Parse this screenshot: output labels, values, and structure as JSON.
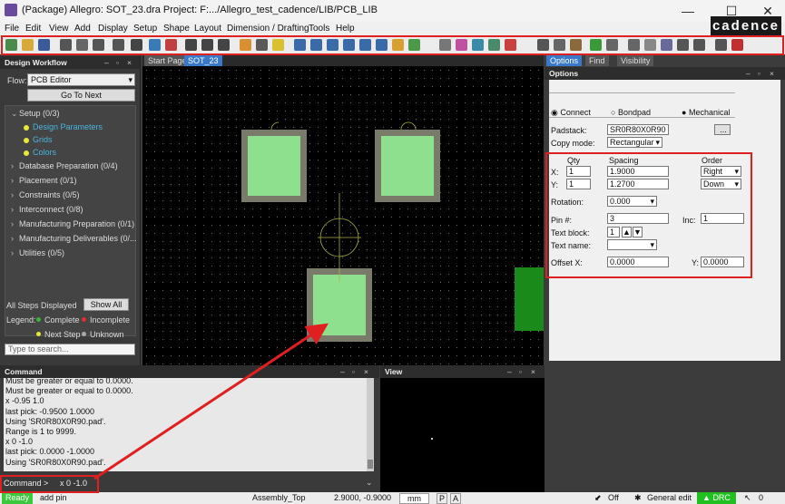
{
  "window": {
    "title": "(Package) Allegro: SOT_23.dra  Project: F:.../Allegro_test_cadence/LIB/PCB_LIB",
    "minimize": "—",
    "maximize": "☐",
    "close": "✕"
  },
  "menu": {
    "items": [
      "File",
      "Edit",
      "View",
      "Add",
      "Display",
      "Setup",
      "Shape",
      "Layout",
      "Dimension / Drafting",
      "Tools",
      "Help"
    ]
  },
  "brand": "cadence",
  "workflow": {
    "title": "Design Workflow",
    "flow_label": "Flow:",
    "flow_value": "PCB Editor",
    "goto": "Go To Next",
    "tree": [
      {
        "label": "Setup  (0/3)",
        "expanded": true
      },
      {
        "label": "Design Parameters",
        "sub": true
      },
      {
        "label": "Grids",
        "sub": true
      },
      {
        "label": "Colors",
        "sub": true
      },
      {
        "label": "Database Preparation  (0/4)"
      },
      {
        "label": "Placement  (0/1)"
      },
      {
        "label": "Constraints  (0/5)"
      },
      {
        "label": "Interconnect  (0/8)"
      },
      {
        "label": "Manufacturing Preparation  (0/1)"
      },
      {
        "label": "Manufacturing Deliverables  (0/..."
      },
      {
        "label": "Utilities  (0/5)"
      }
    ],
    "steps": "All Steps Displayed",
    "show_all": "Show All",
    "legend_label": "Legend:",
    "legend": [
      {
        "label": "Complete",
        "color": "#3cb43c"
      },
      {
        "label": "Incomplete",
        "color": "#e03030"
      },
      {
        "label": "Next Step",
        "color": "#e8e83c"
      },
      {
        "label": "Unknown",
        "color": "#aaaaaa"
      }
    ],
    "search_placeholder": "Type to search..."
  },
  "canvas_tabs": [
    "Start Page",
    "SOT_23"
  ],
  "options": {
    "tabs": [
      "Options",
      "Find",
      "Visibility"
    ],
    "title": "Options",
    "radios": [
      "Connect",
      "Bondpad",
      "Mechanical"
    ],
    "padstack_label": "Padstack:",
    "padstack": "SR0R80X0R90",
    "browse": "...",
    "copy_mode_label": "Copy mode:",
    "copy_mode": "Rectangular",
    "qty_h": "Qty",
    "spacing_h": "Spacing",
    "order_h": "Order",
    "x_label": "X:",
    "y_label": "Y:",
    "x_qty": "1",
    "x_spacing": "1.9000",
    "x_order": "Right",
    "y_qty": "1",
    "y_spacing": "1.2700",
    "y_order": "Down",
    "rotation_label": "Rotation:",
    "rotation": "0.000",
    "pin_label": "Pin #:",
    "pin": "3",
    "inc_label": "Inc:",
    "inc": "1",
    "text_block_label": "Text block:",
    "text_block": "1",
    "text_name_label": "Text name:",
    "text_name": "",
    "offset_x_label": "Offset X:",
    "offset_x": "0.0000",
    "offset_y_label": "Y:",
    "offset_y": "0.0000"
  },
  "command": {
    "title": "Command",
    "lines": [
      "Must be greater or equal to 0.0000.",
      "Must be greater or equal to 0.0000.",
      "x -0.95 1.0",
      "last pick:  -0.9500 1.0000",
      "Using 'SR0R80X0R90.pad'.",
      "Range is 1 to 9999.",
      "x 0 -1.0",
      "last pick:  0.0000 -1.0000",
      "Using 'SR0R80X0R90.pad'."
    ],
    "prompt": "Command >",
    "input": "x 0 -1.0"
  },
  "view": {
    "title": "View"
  },
  "status": {
    "ready": "Ready",
    "cmd": "add pin",
    "layer": "Assembly_Top",
    "coords": "2.9000, -0.9000",
    "units": "mm",
    "p": "P",
    "a": "A",
    "off": "Off",
    "edit_mode": "General edit",
    "drc": "DRC",
    "drc_count": "0"
  },
  "colors": {
    "pad_fill": "#8ee08e",
    "pad_border": "#7a7a6a",
    "highlight": "#e02020"
  }
}
